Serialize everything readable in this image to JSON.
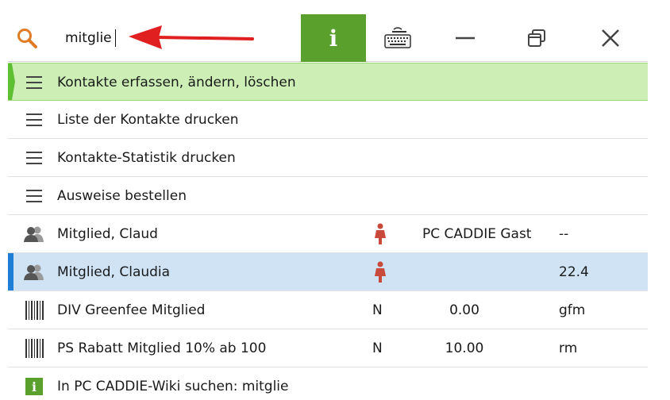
{
  "search": {
    "value": "mitglie"
  },
  "toolbar": {
    "info_glyph": "i",
    "icons": [
      "search-icon",
      "info-icon",
      "keyboard-icon",
      "minimize-icon",
      "restore-icon",
      "close-icon"
    ]
  },
  "colors": {
    "accent_green": "#5aa02c",
    "selected_row": "#cdefb6",
    "highlight_row": "#cfe3f5",
    "arrow": "#e02020",
    "gender_female": "#c94a3a"
  },
  "results": {
    "menu": [
      {
        "label": "Kontakte erfassen, ändern, löschen",
        "icon": "menu-icon"
      },
      {
        "label": "Liste der Kontakte drucken",
        "icon": "menu-icon"
      },
      {
        "label": "Kontakte-Statistik drucken",
        "icon": "menu-icon"
      },
      {
        "label": "Ausweise bestellen",
        "icon": "menu-icon"
      }
    ],
    "persons": [
      {
        "label": "Mitglied, Claud",
        "group": "PC CADDIE Gast",
        "handicap": "--",
        "icon": "person-icon",
        "gender_icon": "female-icon"
      },
      {
        "label": "Mitglied, Claudia",
        "group": "",
        "handicap": "22.4",
        "icon": "person-icon",
        "gender_icon": "female-icon"
      }
    ],
    "articles": [
      {
        "label": "DIV Greenfee Mitglied",
        "flag": "N",
        "amount": "0.00",
        "code": "gfm",
        "icon": "barcode-icon"
      },
      {
        "label": "PS Rabatt Mitglied 10% ab 100",
        "flag": "N",
        "amount": "10.00",
        "code": "rm",
        "icon": "barcode-icon"
      }
    ],
    "wiki": {
      "label": "In PC CADDIE-Wiki suchen: mitglie",
      "glyph": "i",
      "icon": "info-icon"
    }
  }
}
